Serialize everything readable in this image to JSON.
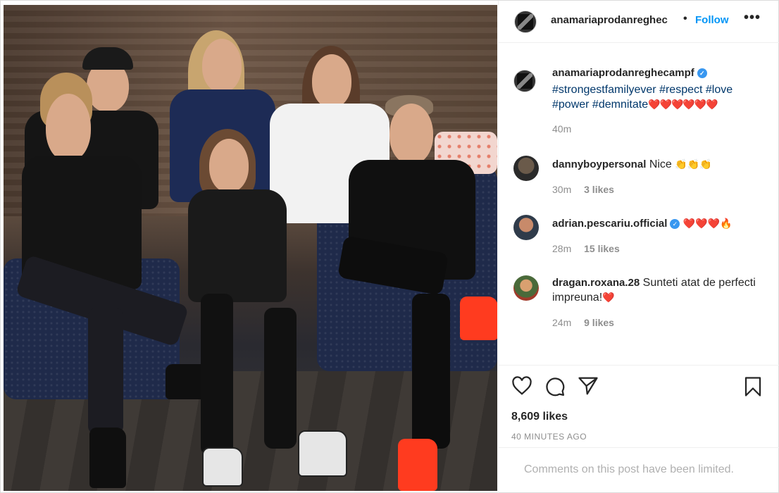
{
  "post": {
    "username": "anamariaprodanreghecampf",
    "username_header": "anamariaprodanreghec",
    "follow_label": "Follow",
    "dot": "•",
    "more_label": "•••",
    "caption_text": "#strongestfamilyever #respect #love #power #demnitate",
    "caption_hearts": "❤️❤️❤️❤️❤️❤️",
    "caption_time": "40m",
    "likes": "8,609 likes",
    "time_ago": "40 MINUTES AGO",
    "comments_limited": "Comments on this post have been limited."
  },
  "comments": [
    {
      "user": "dannyboypersonal",
      "text": "Nice",
      "emoji": "👏👏👏",
      "time": "30m",
      "likes": "3 likes",
      "verified": false
    },
    {
      "user": "adrian.pescariu.official",
      "text": "",
      "emoji": "❤️❤️❤️🔥",
      "time": "28m",
      "likes": "15 likes",
      "verified": true
    },
    {
      "user": "dragan.roxana.28",
      "text": "Sunteti atat de perfecti impreuna!",
      "emoji": "❤️",
      "time": "24m",
      "likes": "9 likes",
      "verified": false
    }
  ],
  "icons": {
    "like": "heart-icon",
    "comment": "comment-icon",
    "share": "share-icon",
    "save": "bookmark-icon",
    "verified": "verified-badge-icon"
  },
  "colors": {
    "accent": "#0095f6",
    "hashtag": "#00376b",
    "muted": "#8e8e8e",
    "verified": "#3897f0"
  }
}
